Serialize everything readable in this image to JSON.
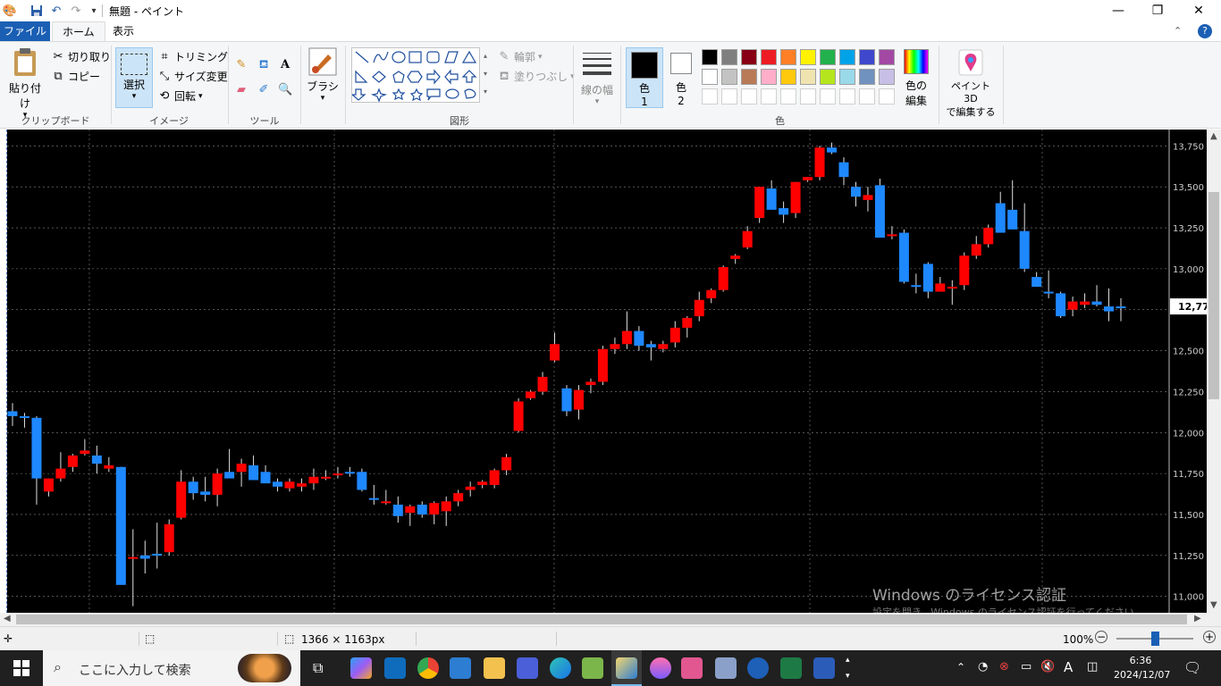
{
  "window": {
    "title": "無題 - ペイント",
    "minimize": "—",
    "restore": "❐",
    "close": "✕"
  },
  "tabs": {
    "file": "ファイル",
    "home": "ホーム",
    "view": "表示"
  },
  "ribbon": {
    "clipboard": {
      "paste": "貼り付け",
      "cut": "切り取り",
      "copy": "コピー",
      "label": "クリップボード"
    },
    "image": {
      "select": "選択",
      "crop": "トリミング",
      "resize": "サイズ変更",
      "rotate": "回転",
      "label": "イメージ"
    },
    "tools": {
      "label": "ツール"
    },
    "brush": {
      "label": "ブラシ"
    },
    "shapes": {
      "outline": "輪郭",
      "fill": "塗りつぶし",
      "label": "図形"
    },
    "size": {
      "label": "線の幅"
    },
    "colors": {
      "color1": "色\n1",
      "color1_a": "色",
      "color1_b": "1",
      "color2_a": "色",
      "color2_b": "2",
      "edit_a": "色の",
      "edit_b": "編集",
      "label": "色",
      "palette_row1": [
        "#000000",
        "#7f7f7f",
        "#880015",
        "#ed1c24",
        "#ff7f27",
        "#fff200",
        "#22b14c",
        "#00a2e8",
        "#3f48cc",
        "#a349a4"
      ],
      "palette_row2": [
        "#ffffff",
        "#c3c3c3",
        "#b97a57",
        "#ffaec9",
        "#ffc90e",
        "#efe4b0",
        "#b5e61d",
        "#99d9ea",
        "#7092be",
        "#c8bfe7"
      ]
    },
    "paint3d": {
      "line1": "ペイント 3D",
      "line2": "で編集する"
    }
  },
  "chart_data": {
    "type": "candlestick",
    "y_ticks": [
      "13,750",
      "13,500",
      "13,250",
      "13,000",
      "12,750",
      "12,500",
      "12,250",
      "12,000",
      "11,750",
      "11,500",
      "11,250",
      "11,000"
    ],
    "current_price_label": "12,77",
    "ylim": [
      10900,
      13850
    ],
    "up_color": "#ff0000",
    "down_color": "#1e88ff",
    "candles": [
      [
        12130,
        12180,
        12040,
        12100
      ],
      [
        12100,
        12120,
        12030,
        12090
      ],
      [
        12090,
        12100,
        11560,
        11720
      ],
      [
        11640,
        11720,
        11610,
        11720
      ],
      [
        11720,
        11880,
        11700,
        11780
      ],
      [
        11790,
        11870,
        11760,
        11860
      ],
      [
        11870,
        11960,
        11860,
        11890
      ],
      [
        11860,
        11920,
        11750,
        11810
      ],
      [
        11780,
        11850,
        11760,
        11800
      ],
      [
        11790,
        11790,
        11080,
        11070
      ],
      [
        11230,
        11410,
        10940,
        11240
      ],
      [
        11250,
        11340,
        11140,
        11230
      ],
      [
        11260,
        11450,
        11170,
        11250
      ],
      [
        11270,
        11470,
        11250,
        11440
      ],
      [
        11480,
        11770,
        11470,
        11700
      ],
      [
        11700,
        11730,
        11590,
        11630
      ],
      [
        11640,
        11730,
        11580,
        11620
      ],
      [
        11620,
        11780,
        11550,
        11750
      ],
      [
        11760,
        11900,
        11730,
        11720
      ],
      [
        11760,
        11840,
        11670,
        11810
      ],
      [
        11800,
        11860,
        11770,
        11710
      ],
      [
        11760,
        11800,
        11700,
        11690
      ],
      [
        11700,
        11720,
        11640,
        11670
      ],
      [
        11660,
        11720,
        11640,
        11700
      ],
      [
        11670,
        11720,
        11640,
        11690
      ],
      [
        11690,
        11780,
        11650,
        11730
      ],
      [
        11730,
        11770,
        11710,
        11730
      ],
      [
        11740,
        11790,
        11720,
        11750
      ],
      [
        11760,
        11790,
        11730,
        11750
      ],
      [
        11760,
        11780,
        11640,
        11650
      ],
      [
        11600,
        11680,
        11560,
        11590
      ],
      [
        11580,
        11650,
        11560,
        11580
      ],
      [
        11560,
        11610,
        11450,
        11490
      ],
      [
        11510,
        11560,
        11430,
        11550
      ],
      [
        11560,
        11580,
        11480,
        11500
      ],
      [
        11500,
        11580,
        11440,
        11570
      ],
      [
        11520,
        11610,
        11430,
        11580
      ],
      [
        11580,
        11650,
        11550,
        11630
      ],
      [
        11650,
        11700,
        11610,
        11670
      ],
      [
        11680,
        11710,
        11660,
        11700
      ],
      [
        11680,
        11780,
        11660,
        11770
      ],
      [
        11770,
        11870,
        11740,
        11850
      ],
      [
        12010,
        12210,
        12000,
        12190
      ],
      [
        12210,
        12260,
        12200,
        12250
      ],
      [
        12250,
        12370,
        12230,
        12340
      ],
      [
        12440,
        12610,
        12430,
        12540
      ],
      [
        12270,
        12290,
        12100,
        12130
      ],
      [
        12140,
        12290,
        12080,
        12260
      ],
      [
        12290,
        12330,
        12240,
        12310
      ],
      [
        12310,
        12530,
        12290,
        12510
      ],
      [
        12510,
        12580,
        12480,
        12540
      ],
      [
        12540,
        12740,
        12510,
        12620
      ],
      [
        12620,
        12650,
        12500,
        12530
      ],
      [
        12540,
        12560,
        12440,
        12520
      ],
      [
        12510,
        12560,
        12490,
        12540
      ],
      [
        12550,
        12680,
        12520,
        12640
      ],
      [
        12640,
        12710,
        12580,
        12700
      ],
      [
        12710,
        12860,
        12680,
        12810
      ],
      [
        12820,
        12880,
        12790,
        12870
      ],
      [
        12870,
        13020,
        12860,
        13010
      ],
      [
        13060,
        13090,
        13030,
        13080
      ],
      [
        13130,
        13260,
        13120,
        13230
      ],
      [
        13310,
        13460,
        13280,
        13500
      ],
      [
        13490,
        13540,
        13380,
        13360
      ],
      [
        13370,
        13410,
        13280,
        13330
      ],
      [
        13340,
        13530,
        13310,
        13530
      ],
      [
        13540,
        13560,
        13530,
        13560
      ],
      [
        13560,
        13750,
        13540,
        13740
      ],
      [
        13740,
        13770,
        13700,
        13710
      ],
      [
        13650,
        13680,
        13510,
        13560
      ],
      [
        13500,
        13530,
        13380,
        13440
      ],
      [
        13420,
        13500,
        13350,
        13450
      ],
      [
        13510,
        13550,
        13200,
        13190
      ],
      [
        13200,
        13260,
        13180,
        13210
      ],
      [
        13220,
        13240,
        12910,
        12920
      ],
      [
        12900,
        12970,
        12850,
        12890
      ],
      [
        13030,
        13040,
        12820,
        12860
      ],
      [
        12860,
        12950,
        12860,
        12910
      ],
      [
        12880,
        12930,
        12780,
        12890
      ],
      [
        12900,
        13100,
        12870,
        13080
      ],
      [
        13080,
        13200,
        13060,
        13150
      ],
      [
        13150,
        13270,
        13130,
        13250
      ],
      [
        13400,
        13470,
        13230,
        13220
      ],
      [
        13360,
        13540,
        13320,
        13240
      ],
      [
        13230,
        13400,
        12980,
        13000
      ],
      [
        12950,
        12980,
        12900,
        12890
      ],
      [
        12860,
        12990,
        12820,
        12850
      ],
      [
        12850,
        12860,
        12700,
        12710
      ],
      [
        12750,
        12830,
        12710,
        12800
      ],
      [
        12780,
        12850,
        12760,
        12800
      ],
      [
        12800,
        12900,
        12770,
        12780
      ],
      [
        12770,
        12880,
        12680,
        12740
      ],
      [
        12770,
        12820,
        12680,
        12760
      ]
    ]
  },
  "watermark": {
    "line1": "Windows のライセンス認証",
    "line2": "設定を開き、Windows のライセンス認証を行ってください。"
  },
  "status": {
    "image_size": "1366 × 1163px",
    "zoom": "100%"
  },
  "taskbar": {
    "search_placeholder": "ここに入力して検索",
    "time": "6:36",
    "date": "2024/12/07",
    "ime": "A"
  }
}
